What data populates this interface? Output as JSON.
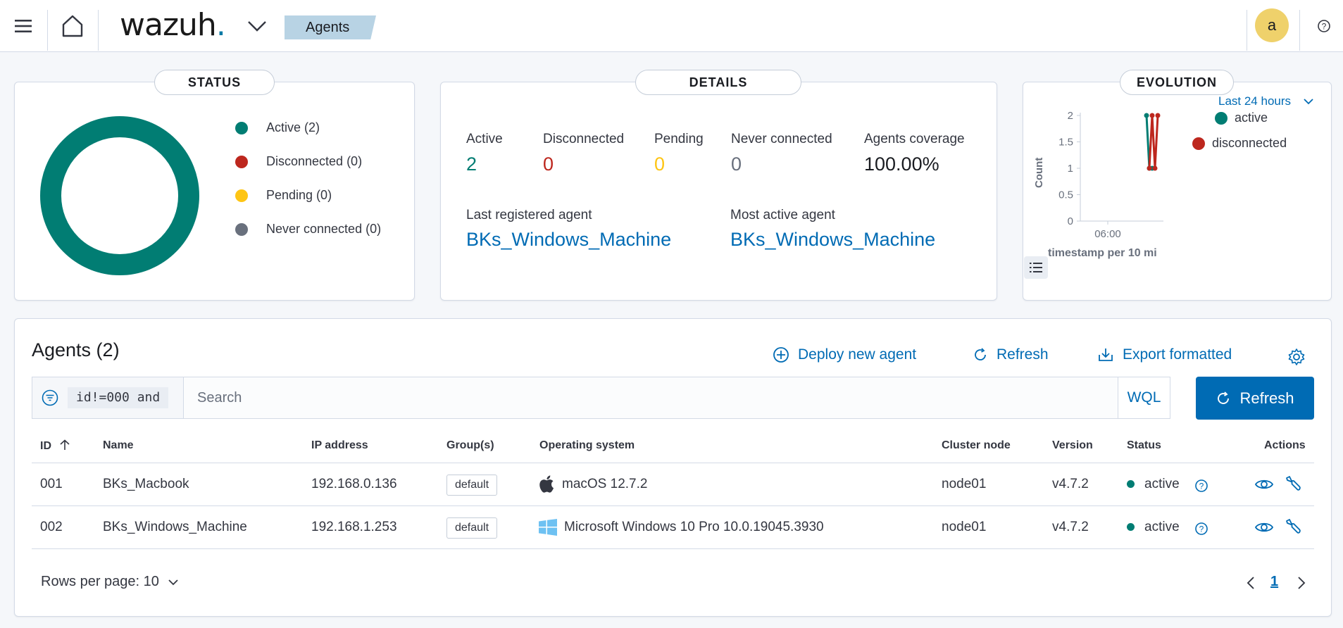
{
  "header": {
    "logo_text": "wazuh",
    "logo_dot": ".",
    "breadcrumb": "Agents",
    "user_initial": "a"
  },
  "status_panel": {
    "title": "STATUS",
    "legend": [
      {
        "label": "Active (2)",
        "color": "#017d73"
      },
      {
        "label": "Disconnected (0)",
        "color": "#bd271e"
      },
      {
        "label": "Pending (0)",
        "color": "#fec514"
      },
      {
        "label": "Never connected (0)",
        "color": "#69707d"
      }
    ],
    "donut_color": "#017d73"
  },
  "details_panel": {
    "title": "DETAILS",
    "stats": [
      {
        "label": "Active",
        "value": "2",
        "color": "#017d73"
      },
      {
        "label": "Disconnected",
        "value": "0",
        "color": "#bd271e"
      },
      {
        "label": "Pending",
        "value": "0",
        "color": "#fec514"
      },
      {
        "label": "Never connected",
        "value": "0",
        "color": "#69707d"
      },
      {
        "label": "Agents coverage",
        "value": "100.00%",
        "color": "#1a1c21"
      }
    ],
    "last_registered_label": "Last registered agent",
    "last_registered_value": "BKs_Windows_Machine",
    "most_active_label": "Most active agent",
    "most_active_value": "BKs_Windows_Machine"
  },
  "evolution_panel": {
    "title": "EVOLUTION",
    "range_label": "Last 24 hours",
    "legend": [
      {
        "label": "active",
        "color": "#017d73"
      },
      {
        "label": "disconnected",
        "color": "#bd271e"
      }
    ],
    "chart_data": {
      "type": "line",
      "ylabel": "Count",
      "xlabel": "timestamp per 10 mi",
      "yticks": [
        "0",
        "0.5",
        "1",
        "1.5",
        "2"
      ],
      "xticks": [
        "06:00"
      ],
      "ylim": [
        0,
        2
      ],
      "series": [
        {
          "name": "active",
          "color": "#017d73",
          "values": [
            2,
            1,
            1
          ]
        },
        {
          "name": "disconnected",
          "color": "#bd271e",
          "values": [
            1,
            2,
            1,
            2
          ]
        }
      ]
    }
  },
  "agents_panel": {
    "title": "Agents (2)",
    "actions": {
      "deploy": "Deploy new agent",
      "refresh": "Refresh",
      "export": "Export formatted"
    },
    "search": {
      "filter_chip": "id!=000 and",
      "placeholder": "Search",
      "wql_label": "WQL",
      "refresh_button": "Refresh"
    },
    "columns": [
      "ID",
      "Name",
      "IP address",
      "Group(s)",
      "Operating system",
      "Cluster node",
      "Version",
      "Status",
      "Actions"
    ],
    "rows": [
      {
        "id": "001",
        "name": "BKs_Macbook",
        "ip": "192.168.0.136",
        "group": "default",
        "os": "macOS 12.7.2",
        "os_icon": "apple-icon",
        "node": "node01",
        "version": "v4.7.2",
        "status": "active"
      },
      {
        "id": "002",
        "name": "BKs_Windows_Machine",
        "ip": "192.168.1.253",
        "group": "default",
        "os": "Microsoft Windows 10 Pro 10.0.19045.3930",
        "os_icon": "windows-icon",
        "node": "node01",
        "version": "v4.7.2",
        "status": "active"
      }
    ],
    "pagination": {
      "rows_per_page": "Rows per page: 10",
      "current_page": "1"
    }
  }
}
